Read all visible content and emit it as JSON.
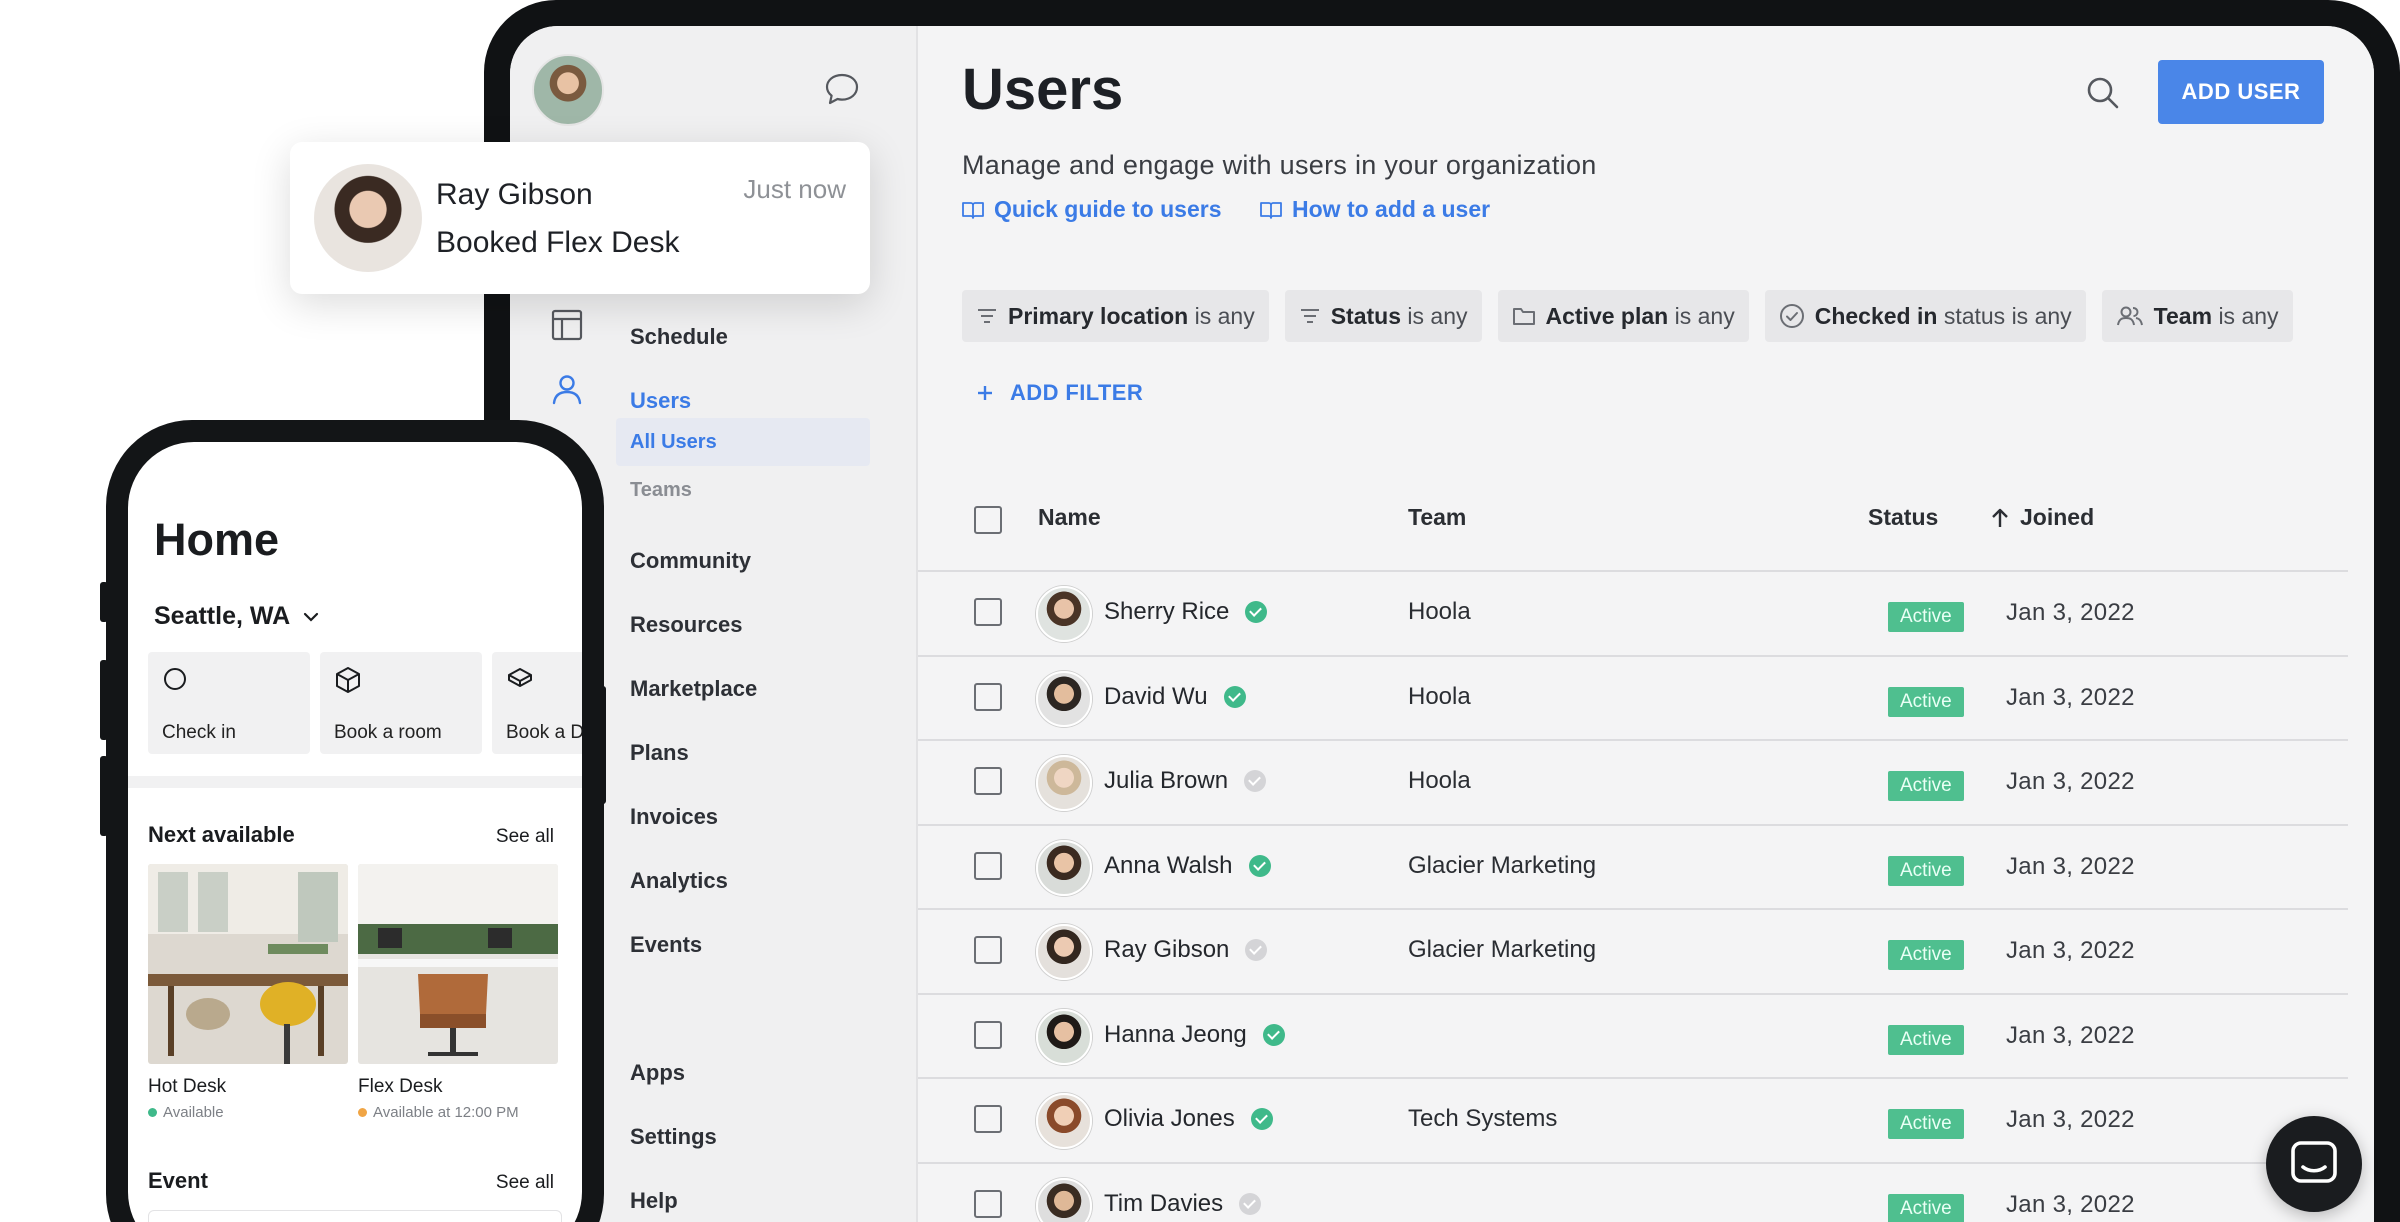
{
  "header": {
    "title": "Users",
    "subtitle": "Manage and engage with users in your organization",
    "links": [
      {
        "label": "Quick guide to users",
        "icon": "book-icon"
      },
      {
        "label": "How to add a user",
        "icon": "book-icon"
      }
    ],
    "add_user_label": "ADD USER",
    "search_icon": "search-icon"
  },
  "sidebar": {
    "items": [
      {
        "label": "Schedule",
        "icon": "schedule-icon"
      },
      {
        "label": "Users",
        "icon": "user-icon",
        "active": true
      },
      {
        "label": "Community"
      },
      {
        "label": "Resources"
      },
      {
        "label": "Marketplace"
      },
      {
        "label": "Plans"
      },
      {
        "label": "Invoices"
      },
      {
        "label": "Analytics"
      },
      {
        "label": "Events"
      },
      {
        "label": "Apps"
      },
      {
        "label": "Settings"
      },
      {
        "label": "Help"
      }
    ],
    "sub_items": [
      {
        "label": "All Users",
        "active": true
      },
      {
        "label": "Teams"
      }
    ]
  },
  "filters": [
    {
      "field": "Primary location",
      "value": "is any",
      "icon": "filter-lines-icon"
    },
    {
      "field": "Status",
      "value": "is any",
      "icon": "filter-lines-icon"
    },
    {
      "field": "Active plan",
      "value": "is any",
      "icon": "folder-icon"
    },
    {
      "field": "Checked in",
      "value": "status is any",
      "icon": "check-circle-icon"
    },
    {
      "field": "Team",
      "value": "is any",
      "icon": "team-icon"
    }
  ],
  "add_filter_label": "ADD FILTER",
  "table": {
    "columns": [
      "Name",
      "Team",
      "Status",
      "Joined"
    ],
    "rows": [
      {
        "name": "Sherry Rice",
        "verified": true,
        "team": "Hoola",
        "status": "Active",
        "joined": "Jan 3, 2022"
      },
      {
        "name": "David Wu",
        "verified": true,
        "team": "Hoola",
        "status": "Active",
        "joined": "Jan 3, 2022"
      },
      {
        "name": "Julia Brown",
        "verified": false,
        "team": "Hoola",
        "status": "Active",
        "joined": "Jan 3, 2022"
      },
      {
        "name": "Anna Walsh",
        "verified": true,
        "team": "Glacier Marketing",
        "status": "Active",
        "joined": "Jan 3, 2022"
      },
      {
        "name": "Ray Gibson",
        "verified": false,
        "team": "Glacier Marketing",
        "status": "Active",
        "joined": "Jan 3, 2022"
      },
      {
        "name": "Hanna Jeong",
        "verified": true,
        "team": "",
        "status": "Active",
        "joined": "Jan 3, 2022"
      },
      {
        "name": "Olivia Jones",
        "verified": true,
        "team": "Tech Systems",
        "status": "Active",
        "joined": "Jan 3, 2022"
      },
      {
        "name": "Tim Davies",
        "verified": false,
        "team": "",
        "status": "Active",
        "joined": "Jan 3, 2022"
      }
    ]
  },
  "notification": {
    "name": "Ray Gibson",
    "message": "Booked Flex Desk",
    "time": "Just now"
  },
  "phone": {
    "title": "Home",
    "location": "Seattle, WA",
    "actions": [
      {
        "label": "Check in",
        "icon": "circle-icon"
      },
      {
        "label": "Book a room",
        "icon": "cube-icon"
      },
      {
        "label": "Book a D",
        "icon": "desk-icon"
      }
    ],
    "next_available": {
      "title": "Next available",
      "see_all": "See all",
      "cards": [
        {
          "title": "Hot Desk",
          "sub": "Available",
          "dot_color": "#3fb98a"
        },
        {
          "title": "Flex Desk",
          "sub": "Available at 12:00 PM",
          "dot_color": "#f0a545"
        }
      ]
    },
    "event": {
      "title": "Event",
      "see_all": "See all"
    }
  },
  "colors": {
    "accent": "#4a86e8",
    "link": "#3b7be6",
    "active_badge": "#4fbf8f",
    "verified": "#3fb98a"
  }
}
